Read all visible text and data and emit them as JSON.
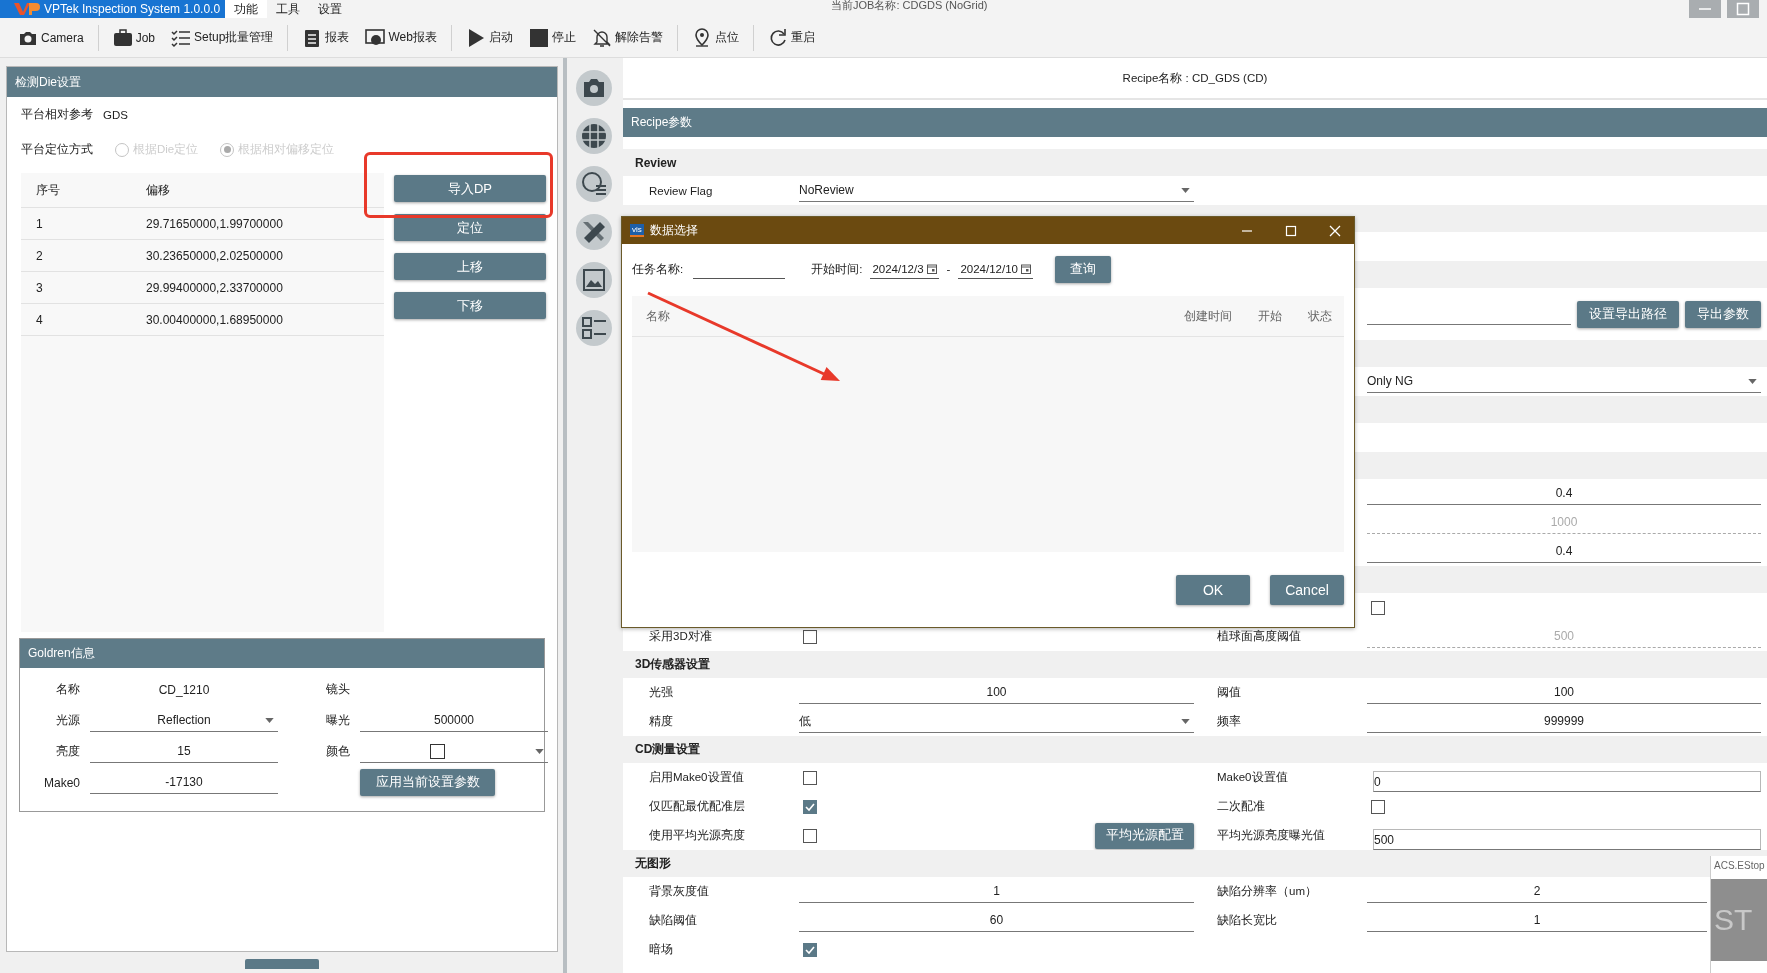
{
  "title_bar": {
    "app_title": "VPTek Inspection System 1.0.0.0",
    "menus": [
      {
        "label": "功能",
        "selected": true
      },
      {
        "label": "工具",
        "selected": false
      },
      {
        "label": "设置",
        "selected": false
      }
    ],
    "job_name": "当前JOB名称: CDGDS (NoGrid)"
  },
  "toolbar": [
    {
      "kind": "camera",
      "label": "Camera",
      "divider_after": true
    },
    {
      "kind": "job",
      "label": "Job",
      "divider_after": false
    },
    {
      "kind": "setup",
      "label": "Setup批量管理",
      "divider_after": true
    },
    {
      "kind": "report",
      "label": "报表",
      "divider_after": false
    },
    {
      "kind": "web",
      "label": "Web报表",
      "divider_after": true
    },
    {
      "kind": "start",
      "label": "启动",
      "divider_after": false
    },
    {
      "kind": "stop",
      "label": "停止",
      "divider_after": false
    },
    {
      "kind": "alarm",
      "label": "解除告警",
      "divider_after": true
    },
    {
      "kind": "point",
      "label": "点位",
      "divider_after": true
    },
    {
      "kind": "restart",
      "label": "重启",
      "divider_after": false
    }
  ],
  "die_panel": {
    "title": "检测Die设置",
    "reference_label": "平台相对参考",
    "reference_value": "GDS",
    "positioning_label": "平台定位方式",
    "positioning_options": [
      {
        "label": "根据Die定位",
        "selected": false,
        "disabled": true
      },
      {
        "label": "根据相对偏移定位",
        "selected": true,
        "disabled": true
      }
    ],
    "table": {
      "columns": [
        "序号",
        "偏移"
      ],
      "rows": [
        [
          "1",
          "29.71650000,1.99700000"
        ],
        [
          "2",
          "30.23650000,2.02500000"
        ],
        [
          "3",
          "29.99400000,2.33700000"
        ],
        [
          "4",
          "30.00400000,1.68950000"
        ]
      ]
    },
    "buttons": [
      "导入DP",
      "定位",
      "上移",
      "下移"
    ]
  },
  "golden": {
    "title": "Goldren信息",
    "fields": [
      {
        "label": "名称",
        "control": {
          "kind": "value",
          "value": "CD_1210"
        }
      },
      {
        "label": "镜头"
      },
      {
        "label": "光源",
        "control": {
          "kind": "dropdown",
          "value": "Reflection"
        }
      },
      {
        "label": "曝光",
        "control": {
          "kind": "input",
          "value": "500000",
          "disabled": false
        }
      },
      {
        "label": "亮度",
        "control": {
          "kind": "input",
          "value": "15",
          "disabled": false
        }
      },
      {
        "label": "颜色",
        "control": {
          "kind": "swatch_dropdown"
        }
      },
      {
        "label": "Make0",
        "control": {
          "kind": "input",
          "value": "-17130",
          "disabled": false
        }
      },
      {
        "control": {
          "kind": "button",
          "label": "应用当前设置参数"
        }
      }
    ]
  },
  "recipe": {
    "name": "Recipe名称 : CD_GDS (CD)",
    "title": "Recipe参数",
    "rows": [
      {
        "kind": "section",
        "title": "Review"
      },
      {
        "kind": "row",
        "left": {
          "label": "Review Flag",
          "control": {
            "kind": "dropdown",
            "value": "NoReview"
          }
        }
      },
      {
        "kind": "section"
      },
      {
        "kind": "row"
      },
      {
        "kind": "section"
      },
      {
        "kind": "row",
        "right": {
          "control": {
            "kind": "path",
            "buttons": [
              "设置导出路径",
              "导出参数"
            ]
          }
        }
      },
      {
        "kind": "section"
      },
      {
        "kind": "row",
        "right": {
          "control": {
            "kind": "dropdown",
            "value": "Only NG"
          }
        }
      },
      {
        "kind": "section"
      },
      {
        "kind": "row"
      },
      {
        "kind": "section"
      },
      {
        "kind": "row",
        "right": {
          "control": {
            "kind": "input",
            "value": "0.4",
            "disabled": false
          }
        }
      },
      {
        "kind": "row",
        "right": {
          "control": {
            "kind": "input",
            "value": "1000",
            "disabled": true
          }
        }
      },
      {
        "kind": "row",
        "right": {
          "control": {
            "kind": "input",
            "value": "0.4",
            "disabled": false
          }
        }
      },
      {
        "kind": "section"
      },
      {
        "kind": "row",
        "right": {
          "control": {
            "kind": "checkbox",
            "checked": false
          }
        }
      },
      {
        "kind": "row",
        "left": {
          "label": "采用3D对准",
          "control": {
            "kind": "checkbox",
            "checked": false
          }
        },
        "right": {
          "label": "植球面高度阈值",
          "control": {
            "kind": "input",
            "value": "500",
            "disabled": true
          }
        }
      },
      {
        "kind": "section",
        "title": "3D传感器设置"
      },
      {
        "kind": "row",
        "left": {
          "label": "光强",
          "control": {
            "kind": "input",
            "value": "100",
            "disabled": false
          }
        },
        "right": {
          "label": "阈值",
          "control": {
            "kind": "input",
            "value": "100",
            "disabled": false
          }
        }
      },
      {
        "kind": "row",
        "left": {
          "label": "精度",
          "control": {
            "kind": "dropdown",
            "value": "低"
          }
        },
        "right": {
          "label": "频率",
          "control": {
            "kind": "input",
            "value": "999999",
            "disabled": false
          }
        }
      },
      {
        "kind": "section",
        "title": "CD测量设置"
      },
      {
        "kind": "row",
        "left": {
          "label": "启用Make0设置值",
          "control": {
            "kind": "checkbox",
            "checked": false
          }
        },
        "right": {
          "label": "Make0设置值",
          "control": {
            "kind": "text",
            "value": "0"
          }
        }
      },
      {
        "kind": "row",
        "left": {
          "label": "仅匹配最优配准层",
          "control": {
            "kind": "checkbox",
            "checked": true
          }
        },
        "right": {
          "label": "二次配准",
          "control": {
            "kind": "checkbox",
            "checked": false
          }
        }
      },
      {
        "kind": "row",
        "left": {
          "label": "使用平均光源亮度",
          "control": {
            "kind": "checkbox",
            "checked": false,
            "button": "平均光源配置"
          }
        },
        "right": {
          "label": "平均光源亮度曝光值",
          "control": {
            "kind": "text",
            "value": "500"
          }
        }
      },
      {
        "kind": "section",
        "title": "无图形"
      },
      {
        "kind": "row",
        "left": {
          "label": "背景灰度值",
          "control": {
            "kind": "input",
            "value": "1",
            "disabled": false
          }
        },
        "right": {
          "label": "缺陷分辨率（um）",
          "control": {
            "kind": "input",
            "value": "2",
            "disabled": false
          }
        }
      },
      {
        "kind": "row",
        "left": {
          "label": "缺陷阈值",
          "control": {
            "kind": "input",
            "value": "60",
            "disabled": false
          }
        },
        "right": {
          "label": "缺陷长宽比",
          "control": {
            "kind": "input",
            "value": "1",
            "disabled": false
          }
        }
      },
      {
        "kind": "row",
        "left": {
          "label": "暗场",
          "control": {
            "kind": "checkbox",
            "checked": true
          }
        }
      }
    ]
  },
  "dialog": {
    "app_icon_text": "vis",
    "title": "数据选择",
    "task_label": "任务名称:",
    "start_label": "开始时间:",
    "date_from": "2024/12/3",
    "separator": "-",
    "date_to": "2024/12/10",
    "query_button": "查询",
    "columns": [
      "名称",
      "创建时间",
      "开始",
      "状态"
    ],
    "buttons": [
      "OK",
      "Cancel"
    ]
  },
  "estop": {
    "title": "ACS.EStop",
    "label": "ST"
  }
}
